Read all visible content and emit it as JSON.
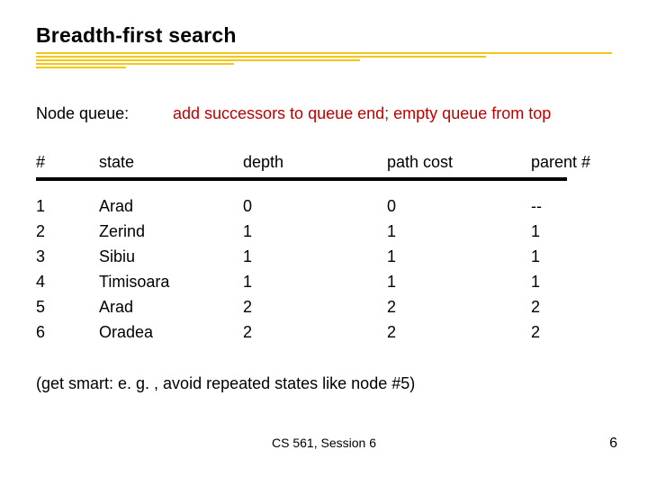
{
  "title": "Breadth-first search",
  "subtitle_label": "Node queue:",
  "subtitle_note": "add successors to queue end; empty queue from top",
  "columns": {
    "num": "#",
    "state": "state",
    "depth": "depth",
    "cost": "path cost",
    "parent": "parent #"
  },
  "rows": [
    {
      "num": "1",
      "state": "Arad",
      "depth": "0",
      "cost": "0",
      "parent": "--"
    },
    {
      "num": "2",
      "state": "Zerind",
      "depth": "1",
      "cost": "1",
      "parent": "1"
    },
    {
      "num": "3",
      "state": "Sibiu",
      "depth": "1",
      "cost": "1",
      "parent": "1"
    },
    {
      "num": "4",
      "state": "Timisoara",
      "depth": "1",
      "cost": "1",
      "parent": "1"
    },
    {
      "num": "5",
      "state": "Arad",
      "depth": "2",
      "cost": "2",
      "parent": "2"
    },
    {
      "num": "6",
      "state": "Oradea",
      "depth": "2",
      "cost": "2",
      "parent": "2"
    }
  ],
  "hint": "(get smart: e. g. , avoid repeated states like node #5)",
  "footer": "CS 561, Session 6",
  "page_number": "6"
}
